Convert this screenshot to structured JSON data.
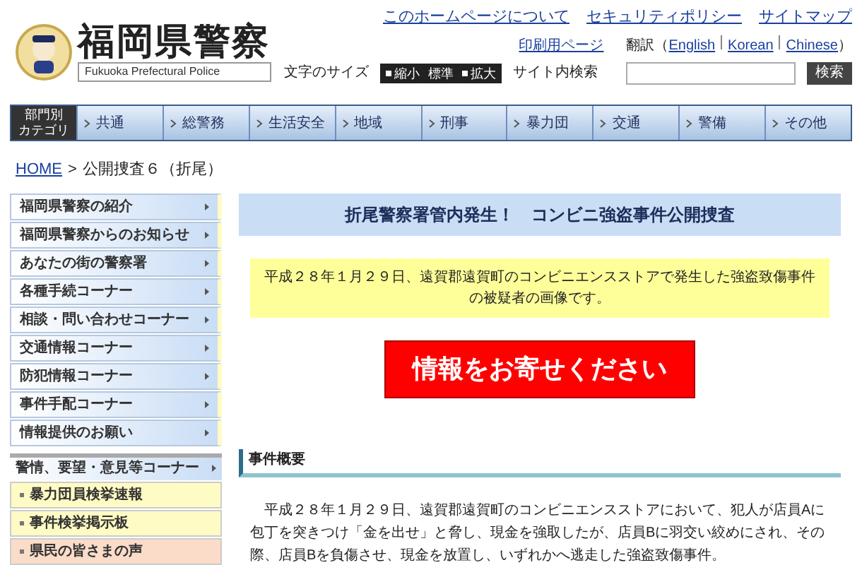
{
  "header": {
    "site_title": "福岡県警察",
    "site_subtitle": "Fukuoka Prefectural Police",
    "top_links": [
      {
        "label": "このホームページについて"
      },
      {
        "label": "セキュリティポリシー"
      },
      {
        "label": "サイトマップ"
      }
    ],
    "print_link": "印刷用ページ",
    "translation": {
      "label": "翻訳",
      "open": "（",
      "languages": [
        "English",
        "Korean",
        "Chinese"
      ],
      "close": "）"
    },
    "font_size": {
      "label": "文字のサイズ",
      "options": [
        {
          "label": "縮小",
          "kind": "arrow"
        },
        {
          "label": "標準",
          "kind": "plain"
        },
        {
          "label": "拡大",
          "kind": "arrow"
        }
      ]
    },
    "search": {
      "label": "サイト内検索",
      "button": "検索"
    }
  },
  "category_nav": {
    "heading": [
      "部門別",
      "カテゴリ"
    ],
    "items": [
      "共通",
      "総警務",
      "生活安全",
      "地域",
      "刑事",
      "暴力団",
      "交通",
      "警備",
      "その他"
    ]
  },
  "breadcrumb": {
    "home": "HOME",
    "separator": ">",
    "current": "公開捜査６（折尾）"
  },
  "sidebar": {
    "items": [
      {
        "label": "福岡県警察の紹介",
        "kind": "main"
      },
      {
        "label": "福岡県警察からのお知らせ",
        "kind": "main"
      },
      {
        "label": "あなたの街の警察署",
        "kind": "main"
      },
      {
        "label": "各種手続コーナー",
        "kind": "main"
      },
      {
        "label": "相談・問い合わせコーナー",
        "kind": "main"
      },
      {
        "label": "交通情報コーナー",
        "kind": "main"
      },
      {
        "label": "防犯情報コーナー",
        "kind": "main"
      },
      {
        "label": "事件手配コーナー",
        "kind": "main"
      },
      {
        "label": "情報提供のお願い",
        "kind": "main"
      },
      {
        "label": "警情、要望・意見等コーナー",
        "kind": "group"
      },
      {
        "label": "暴力団員検挙速報",
        "kind": "sub",
        "color": "#fffbc4"
      },
      {
        "label": "事件検挙掲示板",
        "kind": "sub",
        "color": "#fffbc4"
      },
      {
        "label": "県民の皆さまの声",
        "kind": "sub",
        "color": "#fbdcc8"
      }
    ]
  },
  "main": {
    "title": "折尾警察署管内発生！　コンビニ強盗事件公開捜査",
    "notice": "平成２８年１月２９日、遠賀郡遠賀町のコンビニエンスストアで発生した強盗致傷事件の被疑者の画像です。",
    "call_button": "情報をお寄せください",
    "section_heading": "事件概要",
    "paragraph": "　平成２８年１月２９日、遠賀郡遠賀町のコンビニエンスストアにおいて、犯人が店員Aに包丁を突きつけ「金を出せ」と脅し、現金を強取したが、店員Bに羽交い絞めにされ、その際、店員Bを負傷させ、現金を放置し、いずれかへ逃走した強盗致傷事件。"
  }
}
